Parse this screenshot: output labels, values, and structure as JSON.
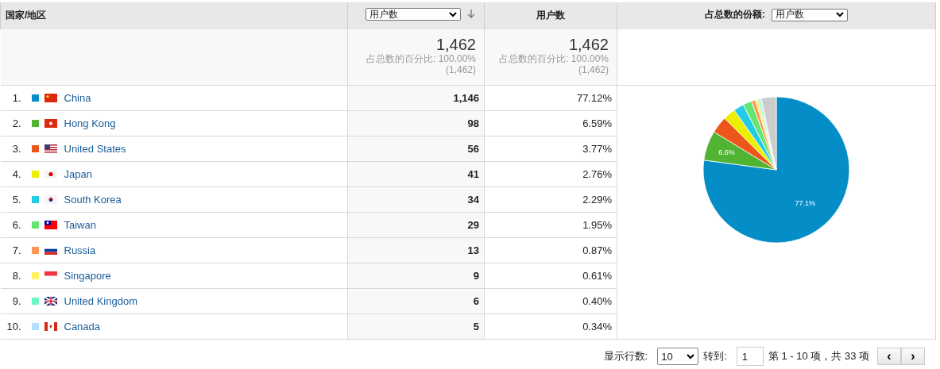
{
  "columns": {
    "dimension": "国家/地区",
    "metric_select": "用户数",
    "metric_sorted": true,
    "metric_2": "用户数",
    "share_label": "占总数的份额:",
    "share_select": "用户数"
  },
  "totals": [
    {
      "value": "1,462",
      "percent_label": "占总数的百分比:",
      "percent": "100.00%",
      "total": "(1,462)"
    },
    {
      "value": "1,462",
      "percent_label": "占总数的百分比:",
      "percent": "100.00%",
      "total": "(1,462)"
    }
  ],
  "rows": [
    {
      "rank": "1.",
      "color": "#058dc7",
      "name": "China",
      "users": "1,146",
      "share": "77.12%"
    },
    {
      "rank": "2.",
      "color": "#50b432",
      "name": "Hong Kong",
      "users": "98",
      "share": "6.59%"
    },
    {
      "rank": "3.",
      "color": "#ed561b",
      "name": "United States",
      "users": "56",
      "share": "3.77%"
    },
    {
      "rank": "4.",
      "color": "#edef00",
      "name": "Japan",
      "users": "41",
      "share": "2.76%"
    },
    {
      "rank": "5.",
      "color": "#24cbe5",
      "name": "South Korea",
      "users": "34",
      "share": "2.29%"
    },
    {
      "rank": "6.",
      "color": "#64e572",
      "name": "Taiwan",
      "users": "29",
      "share": "1.95%"
    },
    {
      "rank": "7.",
      "color": "#ff9655",
      "name": "Russia",
      "users": "13",
      "share": "0.87%"
    },
    {
      "rank": "8.",
      "color": "#fff263",
      "name": "Singapore",
      "users": "9",
      "share": "0.61%"
    },
    {
      "rank": "9.",
      "color": "#6af9c4",
      "name": "United Kingdom",
      "users": "6",
      "share": "0.40%"
    },
    {
      "rank": "10.",
      "color": "#b2deff",
      "name": "Canada",
      "users": "5",
      "share": "0.34%"
    }
  ],
  "chart_data": {
    "type": "pie",
    "values": [
      77.12,
      6.59,
      3.77,
      2.76,
      2.29,
      1.95,
      0.87,
      0.61,
      0.4,
      0.34,
      3.3
    ],
    "colors": [
      "#058dc7",
      "#50b432",
      "#ed561b",
      "#edef00",
      "#24cbe5",
      "#64e572",
      "#ff9655",
      "#fff263",
      "#6af9c4",
      "#b2deff",
      "#cccccc"
    ],
    "value_labels": [
      "77.1%",
      "6.6%",
      null,
      null,
      null,
      null,
      null,
      null,
      null,
      null,
      null
    ]
  },
  "footer": {
    "rows_label": "显示行数:",
    "rows_value": "10",
    "goto_label": "转到:",
    "goto_value": "1",
    "range": "第 1 - 10 项，共 33 项",
    "prev": "‹",
    "next": "›"
  }
}
